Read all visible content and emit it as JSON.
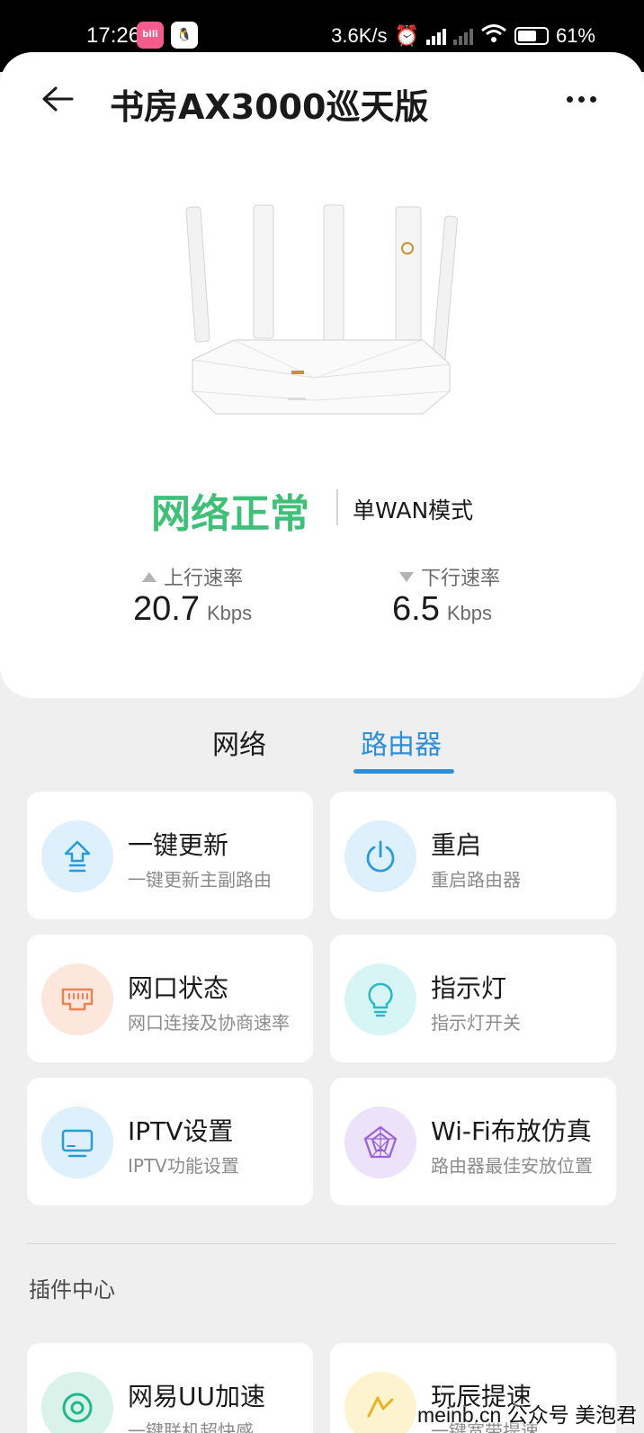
{
  "status_bar": {
    "time": "17:26",
    "app1_icon": "bilibili-icon",
    "app1_text": "bili",
    "app2_icon": "qq-icon",
    "net_speed": "3.6K/s",
    "battery": "61%"
  },
  "header": {
    "title": "书房AX3000巡天版"
  },
  "router": {
    "status": "网络正常",
    "mode": "单WAN模式",
    "upload": {
      "label": "上行速率",
      "value": "20.7",
      "unit": "Kbps"
    },
    "download": {
      "label": "下行速率",
      "value": "6.5",
      "unit": "Kbps"
    },
    "status_color": "#3fbf78"
  },
  "tabs": [
    {
      "label": "网络",
      "active": false
    },
    {
      "label": "路由器",
      "active": true
    }
  ],
  "accent_color": "#2e8fd6",
  "cards": [
    {
      "title": "一键更新",
      "subtitle": "一键更新主副路由",
      "icon": "upgrade-arrow-icon"
    },
    {
      "title": "重启",
      "subtitle": "重启路由器",
      "icon": "power-icon"
    },
    {
      "title": "网口状态",
      "subtitle": "网口连接及协商速率",
      "icon": "ethernet-port-icon"
    },
    {
      "title": "指示灯",
      "subtitle": "指示灯开关",
      "icon": "lightbulb-icon"
    },
    {
      "title": "IPTV设置",
      "subtitle": "IPTV功能设置",
      "icon": "tv-icon"
    },
    {
      "title": "Wi-Fi布放仿真",
      "subtitle": "路由器最佳安放位置",
      "icon": "wifi-placement-icon"
    }
  ],
  "plugins": {
    "section_title": "插件中心",
    "items": [
      {
        "title": "网易UU加速",
        "subtitle": "一键联机超快感",
        "icon": "uu-accelerator-icon"
      },
      {
        "title": "玩辰提速",
        "subtitle": "一键宽带提速",
        "icon": "wanchen-speedup-icon"
      }
    ]
  },
  "watermark": "meinb.cn 公众号 美泡君"
}
